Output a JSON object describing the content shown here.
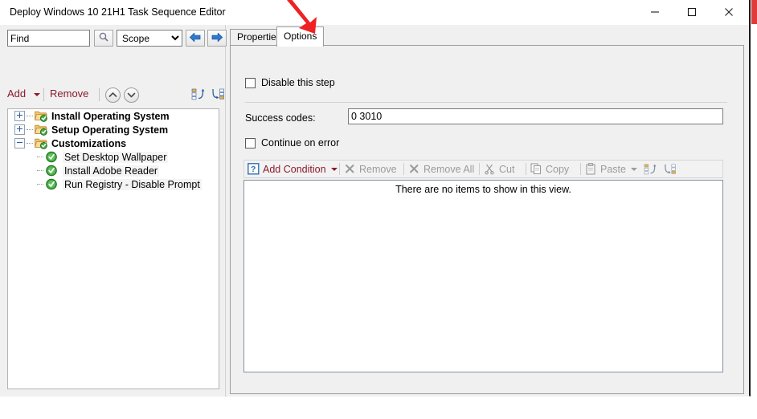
{
  "window": {
    "title": "Deploy Windows 10 21H1 Task Sequence Editor",
    "controls": {
      "minimize": "minimize-icon",
      "maximize": "maximize-icon",
      "close": "close-icon"
    }
  },
  "left_pane": {
    "find": {
      "value": "Find",
      "placeholder": "Find",
      "search_icon": "magnifier-icon"
    },
    "scope": {
      "selected": "Scope",
      "options": [
        "Scope"
      ]
    },
    "nav": {
      "back_icon": "arrow-left-icon",
      "forward_icon": "arrow-right-icon"
    },
    "toolbar": {
      "add_label": "Add",
      "remove_label": "Remove",
      "move_up_icon": "chevron-up-circle-icon",
      "move_down_icon": "chevron-down-circle-icon",
      "indent_icon": "indent-icon",
      "outdent_icon": "outdent-icon"
    },
    "tree": [
      {
        "label": "Install Operating System",
        "level": 0,
        "expander": "plus",
        "icon": "folder-check-icon",
        "bold": true,
        "selected": false
      },
      {
        "label": "Setup Operating System",
        "level": 0,
        "expander": "plus",
        "icon": "folder-check-icon",
        "bold": true,
        "selected": false
      },
      {
        "label": "Customizations",
        "level": 0,
        "expander": "minus",
        "icon": "folder-check-icon",
        "bold": true,
        "selected": false
      },
      {
        "label": "Set Desktop Wallpaper",
        "level": 1,
        "expander": "none",
        "icon": "green-check-circle-icon",
        "bold": false,
        "selected": true
      },
      {
        "label": "Install Adobe Reader",
        "level": 1,
        "expander": "none",
        "icon": "green-check-circle-icon",
        "bold": false,
        "selected": true
      },
      {
        "label": "Run Registry - Disable Prompt",
        "level": 1,
        "expander": "none",
        "icon": "green-check-circle-icon",
        "bold": false,
        "selected": true
      }
    ]
  },
  "right_pane": {
    "tabs": [
      {
        "label": "Properties",
        "active": false
      },
      {
        "label": "Options",
        "active": true
      }
    ],
    "options": {
      "disable_step_label": "Disable this step",
      "disable_step_checked": false,
      "success_codes_label": "Success codes:",
      "success_codes_value": "0 3010",
      "continue_on_error_label": "Continue on error",
      "continue_on_error_checked": false,
      "condition_toolbar": [
        {
          "label": "Add Condition",
          "icon": "question-mark-icon",
          "enabled": true,
          "has_caret": true
        },
        {
          "label": "Remove",
          "icon": "x-icon",
          "enabled": false,
          "has_caret": false
        },
        {
          "label": "Remove All",
          "icon": "x-icon",
          "enabled": false,
          "has_caret": false
        },
        {
          "label": "Cut",
          "icon": "scissors-icon",
          "enabled": false,
          "has_caret": false
        },
        {
          "label": "Copy",
          "icon": "copy-icon",
          "enabled": false,
          "has_caret": false
        },
        {
          "label": "Paste",
          "icon": "clipboard-icon",
          "enabled": false,
          "has_caret": true
        }
      ],
      "condition_toolbar_extra": [
        {
          "icon": "indent-icon"
        },
        {
          "icon": "outdent-icon"
        }
      ],
      "condition_list_empty": "There are no items to show in this view."
    }
  },
  "annotation": {
    "arrow_color": "#ee2222",
    "points_to": "Options"
  },
  "scrollbar": {
    "thumb_color": "#e03a3a"
  }
}
